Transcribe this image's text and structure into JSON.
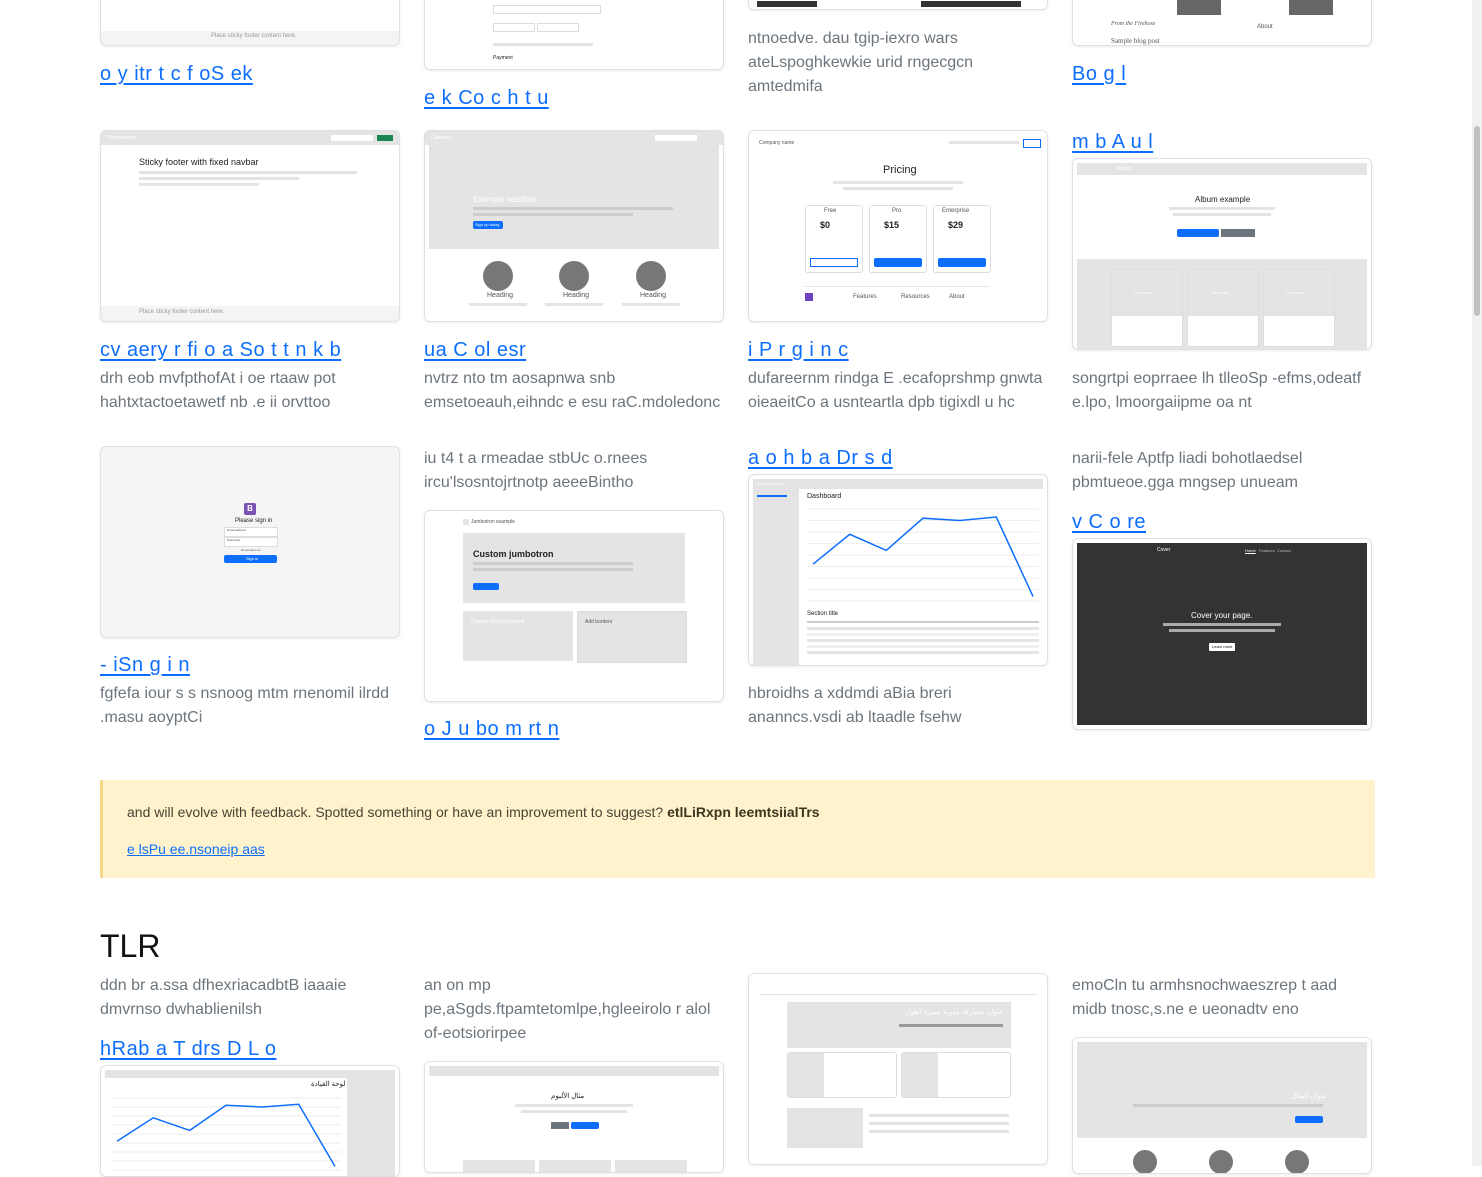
{
  "row0": {
    "col1_title": "o y itr t c f oS ek",
    "col2_title": "e k Co c h t u",
    "col3_desc": "ntnoedve. dau tgip-iexro wars ateLspoghkewkie urid rngecgcn amtedmifa",
    "col4_title": "Bo g l",
    "col1_thumb_footer": "Place sticky footer content here.",
    "col2_thumb_label": "Payment",
    "col4_thumb_text1": "From the Firehose",
    "col4_thumb_text2": "Sample blog post",
    "col4_thumb_about": "About"
  },
  "row1": {
    "col1": {
      "title": "cv aery r fi o a So t t n k b",
      "desc": "drh eob mvfpthofAt i oe rtaaw pot hahtxtactoetawetf nb .e ii orvttoo",
      "thumb_brand": "Fixed navbar",
      "thumb_heading": "Sticky footer with fixed navbar",
      "thumb_footer": "Place sticky footer content here."
    },
    "col2": {
      "title": "ua C ol esr",
      "desc": "nvtrz nto tm aosapnwa snb emsetoeauh,eihndc e esu raC.mdoledonc",
      "thumb_brand": "Carousel",
      "thumb_heading": "Example headline.",
      "thumb_button": "Sign up today",
      "thumb_col_heading": "Heading"
    },
    "col3": {
      "title": "i P r g i n c",
      "desc": "dufareernm rindga E .ecafoprshmp gnwta oieaeitCo a usnteartla dpb tigixdl u hc",
      "thumb_company": "Company name",
      "thumb_heading": "Pricing",
      "tiers": [
        {
          "name": "Free",
          "price": "$0",
          "button": "Sign up for free"
        },
        {
          "name": "Pro",
          "price": "$15",
          "button": "Get started"
        },
        {
          "name": "Enterprise",
          "price": "$29",
          "button": "Contact us"
        }
      ],
      "footer_cols": [
        "Features",
        "Resources",
        "About"
      ]
    },
    "col4": {
      "title": "m b A u l",
      "desc": "songrtpi eoprraee lh tlleoSp -efms,odeatf e.lpo, lmoorgaiipme oa nt",
      "thumb_brand": "Album",
      "thumb_heading": "Album example",
      "thumb_card_label": "Thumbnail",
      "thumb_btn1": "Main call to action",
      "thumb_btn2": "Secondary action"
    }
  },
  "row2": {
    "col1": {
      "title": "- iSn g i n",
      "desc": "fgfefa iour s s nsnoog mtm rnenomil ilrdd .masu aoyptCi",
      "thumb_heading": "Please sign in",
      "thumb_email": "Email address",
      "thumb_password": "Password",
      "thumb_remember": "Remember me",
      "thumb_button": "Sign in",
      "thumb_logo": "B"
    },
    "col2": {
      "desc": "iu t4 t a rmeadae stbUc o.rnees ircu'lsosntojrtnotp aeeeBintho",
      "title": "o J u bo m rt n",
      "thumb_brand": "Jumbotron example",
      "thumb_heading": "Custom jumbotron",
      "thumb_box1": "Change the background",
      "thumb_box2": "Add borders"
    },
    "col3": {
      "title": "a o h b a Dr s d",
      "desc": "hbroidhs a xddmdi aBia breri ananncs.vsdi ab ltaadle fsehw",
      "thumb_company": "Company name",
      "thumb_heading": "Dashboard",
      "thumb_section": "Section title",
      "chart_points": [
        32,
        58,
        44,
        72,
        70,
        73,
        4
      ]
    },
    "col4": {
      "desc": "narii-fele Aptfp liadi bohotlaedsel pbmtueoe.gga mngsep unueam",
      "title": "v C o re",
      "thumb_brand": "Cover",
      "thumb_nav": [
        "Home",
        "Features",
        "Contact"
      ],
      "thumb_heading": "Cover your page.",
      "thumb_button": "Learn more"
    }
  },
  "alert": {
    "text": "and will evolve with feedback. Spotted something or have an improvement to suggest?",
    "bold": "etlLiRxpn leemtsiialTrs",
    "link": "e lsPu ee.nsoneip aas"
  },
  "section": {
    "heading": "TLR",
    "col1": {
      "desc": "ddn br a.ssa dfhexriacadbtB iaaaie dmvrnso dwhablienilsh",
      "title": "hRab a T drs D L o",
      "thumb_heading": "لوحة القيادة"
    },
    "col2": {
      "desc": "an on mp pe,aSgds.ftpamtetomlpe,hgleeirolo r alol of-eotsiorirpee",
      "thumb_heading": "مثال الألبوم"
    },
    "col3": {
      "thumb_heading": "عنوان مشاركة مدونة مميزة أطول"
    },
    "col4": {
      "desc": "emoCln tu armhsnochwaeszrep t aad midb tnosc,s.ne e ueonadtv eno",
      "thumb_heading": "عنوان المثال"
    }
  }
}
